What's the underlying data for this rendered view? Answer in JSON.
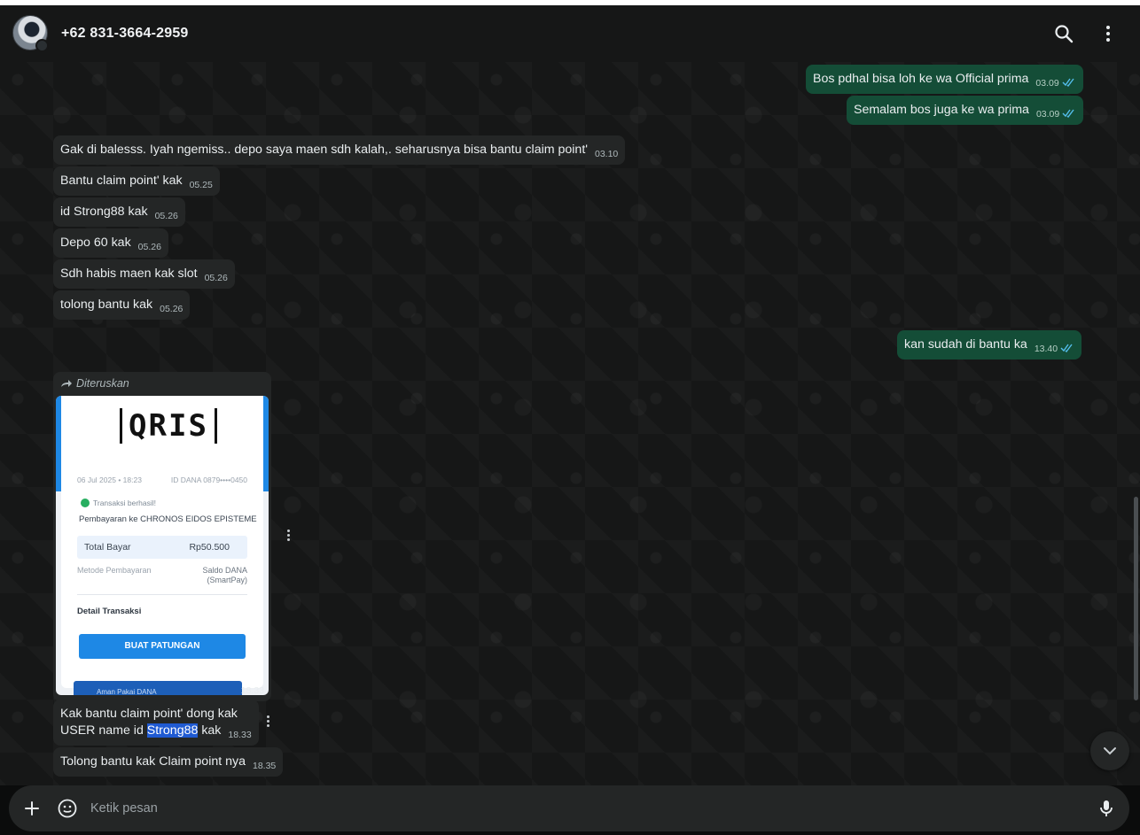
{
  "header": {
    "contact": "+62 831-3664-2959"
  },
  "messages": {
    "out1": {
      "text": "Bos pdhal bisa loh ke wa Official prima",
      "time": "03.09"
    },
    "out2": {
      "text": "Semalam bos juga ke wa prima",
      "time": "03.09"
    },
    "in1": {
      "text": "Gak di balesss. Iyah ngemiss.. depo saya maen sdh kalah,. seharusnya bisa bantu claim point'",
      "time": "03.10"
    },
    "in2": {
      "text": "Bantu claim point' kak",
      "time": "05.25"
    },
    "in3": {
      "text": "id Strong88 kak",
      "time": "05.26"
    },
    "in4": {
      "text": "Depo 60 kak",
      "time": "05.26"
    },
    "in5": {
      "text": "Sdh habis maen kak slot",
      "time": "05.26"
    },
    "in6": {
      "text": "tolong bantu kak",
      "time": "05.26"
    },
    "out3": {
      "text": "kan sudah di bantu ka",
      "time": "13.40"
    },
    "forwarded": {
      "label": "Diteruskan",
      "time": "18.33",
      "receipt": {
        "logo": "QRIS",
        "date": "06 Jul 2025 • 18:23",
        "account": "ID DANA 0879••••0450",
        "status": "Transaksi berhasil!",
        "payee": "Pembayaran ke CHRONOS EIDOS EPISTEME",
        "total_label": "Total Bayar",
        "total_value": "Rp50.500",
        "method_label": "Metode Pembayaran",
        "method_value_1": "Saldo DANA",
        "method_value_2": "(SmartPay)",
        "detail_label": "Detail Transaksi",
        "button": "BUAT PATUNGAN",
        "strip": "Aman Pakai DANA"
      }
    },
    "in7": {
      "line1": "Kak bantu claim point' dong kak",
      "line2_pre": "USER name id ",
      "line2_hl": "Strong88",
      "line2_post": " kak",
      "time": "18.33"
    },
    "in8": {
      "text": "Tolong bantu kak Claim point nya",
      "time": "18.35"
    }
  },
  "composer": {
    "placeholder": "Ketik pesan"
  },
  "colors": {
    "outgoing_bubble": "#144d37",
    "incoming_bubble": "#242626",
    "read_ticks": "#53bdeb"
  }
}
